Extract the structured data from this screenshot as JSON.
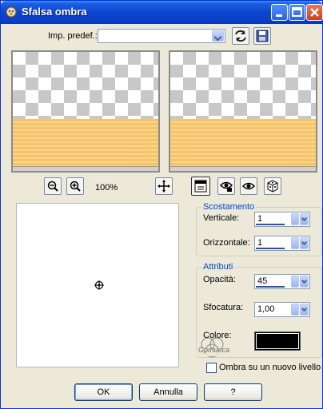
{
  "window": {
    "title": "Sfalsa ombra"
  },
  "preset": {
    "label": "Imp. predef.:",
    "value": ""
  },
  "zoom": {
    "level": "100%"
  },
  "offset": {
    "title": "Scostamento",
    "vertical_label": "Verticale:",
    "vertical_value": "1",
    "horizontal_label": "Orizzontale:",
    "horizontal_value": "1"
  },
  "attributes": {
    "title": "Attributi",
    "opacity_label": "Opacità:",
    "opacity_value": "45",
    "blur_label": "Sfocatura:",
    "blur_value": "1,00",
    "color_label": "Colore:",
    "color_value": "#000000"
  },
  "shadow_new_layer": {
    "label": "Ombra su un nuovo livello",
    "checked": false
  },
  "buttons": {
    "ok": "OK",
    "cancel": "Annulla",
    "help": "?"
  },
  "watermark": {
    "text": "Gpmueca"
  }
}
